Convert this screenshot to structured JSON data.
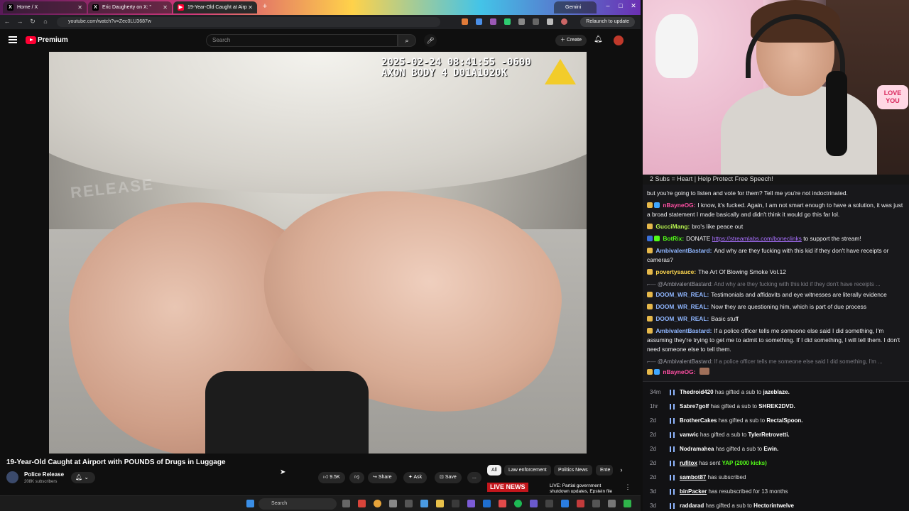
{
  "browser": {
    "tabs": [
      {
        "label": "Home / X",
        "icon": "x-logo-icon"
      },
      {
        "label": "Eric Daugherty on X: \"",
        "icon": "x-logo-icon"
      },
      {
        "label": "19-Year-Old Caught at Airp",
        "icon": "youtube-icon"
      }
    ],
    "gemini_tab": "Gemini",
    "url": "youtube.com/watch?v=Zec0LU3687w",
    "relaunch_label": "Relaunch to update"
  },
  "youtube": {
    "brand": "Premium",
    "search_placeholder": "Search",
    "create_label": "Create",
    "video": {
      "osd_line1": "2025-02-24 08:41:55 -0600",
      "osd_line2": "AXON BODY 4 D01A1020K",
      "watermark": "RELEASE",
      "title": "19-Year-Old Caught at Airport with POUNDS of Drugs in Luggage"
    },
    "channel": {
      "name": "Police Release",
      "subscribers": "208K subscribers"
    },
    "actions": {
      "likes": "9.5K",
      "share": "Share",
      "ask": "Ask",
      "save": "Save",
      "more": "..."
    },
    "chips": [
      "All",
      "Law enforcement",
      "Politics News",
      "Ente"
    ],
    "live": {
      "badge": "LIVE NEWS",
      "text": "LIVE: Partial government shutdown updates, Epstein file"
    }
  },
  "taskbar": {
    "search_placeholder": "Search"
  },
  "stream": {
    "sign": "LOVE YOU",
    "banner": "2 Subs = Heart | Help Protect Free Speech!",
    "chat": [
      {
        "type": "text",
        "text": "but you're going to listen and vote for them? Tell me you're not indoctrinated."
      },
      {
        "type": "msg",
        "user": "nBayneOG:",
        "color": "#ff4fa3",
        "text": "I know, it's fucked. Again, I am not smart enough to have a solution, it was just a broad statement I made basically and didn't think it would go this far lol."
      },
      {
        "type": "msg",
        "user": "GucciMang:",
        "color": "#b9f54f",
        "text": "bro's like peace out"
      },
      {
        "type": "msg",
        "user": "BotRix:",
        "color": "#53fc18",
        "text": "DONATE",
        "link": "https://streamlabs.com/boneclinks",
        "after": "to support the stream!"
      },
      {
        "type": "msg",
        "user": "AmbivalentBastard:",
        "color": "#8fb6ff",
        "text": "And why are they fucking with this kid if they don't have receipts or cameras?"
      },
      {
        "type": "msg",
        "user": "povertysauce:",
        "color": "#ffd84f",
        "text": "The Art Of Blowing Smoke Vol.12"
      },
      {
        "type": "reply",
        "user": "@AmbivalentBastard:",
        "text": "And why are they fucking with this kid if they don't have receipts ..."
      },
      {
        "type": "msg",
        "user": "DOOM_WR_REAL:",
        "color": "#8fb6ff",
        "text": "Testimonials and affidavits and eye witnesses are literally evidence"
      },
      {
        "type": "msg",
        "user": "DOOM_WR_REAL:",
        "color": "#8fb6ff",
        "text": "Now they are questioning him, which is part of due process"
      },
      {
        "type": "msg",
        "user": "DOOM_WR_REAL:",
        "color": "#8fb6ff",
        "text": "Basic stuff"
      },
      {
        "type": "msg",
        "user": "AmbivalentBastard:",
        "color": "#8fb6ff",
        "text": "If a police officer tells me someone else said I did something, I'm assuming they're trying to get me to admit to something. If I did something, I will tell them. I don't need someone else to tell them."
      },
      {
        "type": "reply",
        "user": "@AmbivalentBastard:",
        "text": "If a police officer tells me someone else said I did something, I'm ..."
      },
      {
        "type": "msg",
        "user": "nBayneOG:",
        "color": "#ff4fa3",
        "text": ""
      }
    ],
    "events": [
      {
        "time": "34m",
        "user": "Thedroid420",
        "action": "has gifted a sub to",
        "target": "jazeblaze."
      },
      {
        "time": "1hr",
        "user": "Sabre7golf",
        "action": "has gifted a sub to",
        "target": "SHREK2DVD."
      },
      {
        "time": "2d",
        "user": "BrotherCakes",
        "action": "has gifted a sub to",
        "target": "RectalSpoon."
      },
      {
        "time": "2d",
        "user": "vanwic",
        "action": "has gifted a sub to",
        "target": "TylerRetrovetti."
      },
      {
        "time": "2d",
        "user": "Nodramahea",
        "action": "has gifted a sub to",
        "target": "Ewin."
      },
      {
        "time": "2d",
        "user": "rufitox",
        "action": "has sent",
        "target": "",
        "kicks": "YAP (2000 kicks)"
      },
      {
        "time": "2d",
        "user": "sambot87",
        "action": "has subscribed",
        "target": ""
      },
      {
        "time": "3d",
        "user": "binPacker",
        "action": "has resubscribed for 13 months",
        "target": ""
      },
      {
        "time": "3d",
        "user": "raddarad",
        "action": "has gifted a sub to",
        "target": "Hectorintwelve"
      }
    ]
  },
  "colors": {
    "yt_red": "#ff0033",
    "chat_bg": "#18181b",
    "link": "#a970ff",
    "kicks_green": "#53fc18"
  }
}
